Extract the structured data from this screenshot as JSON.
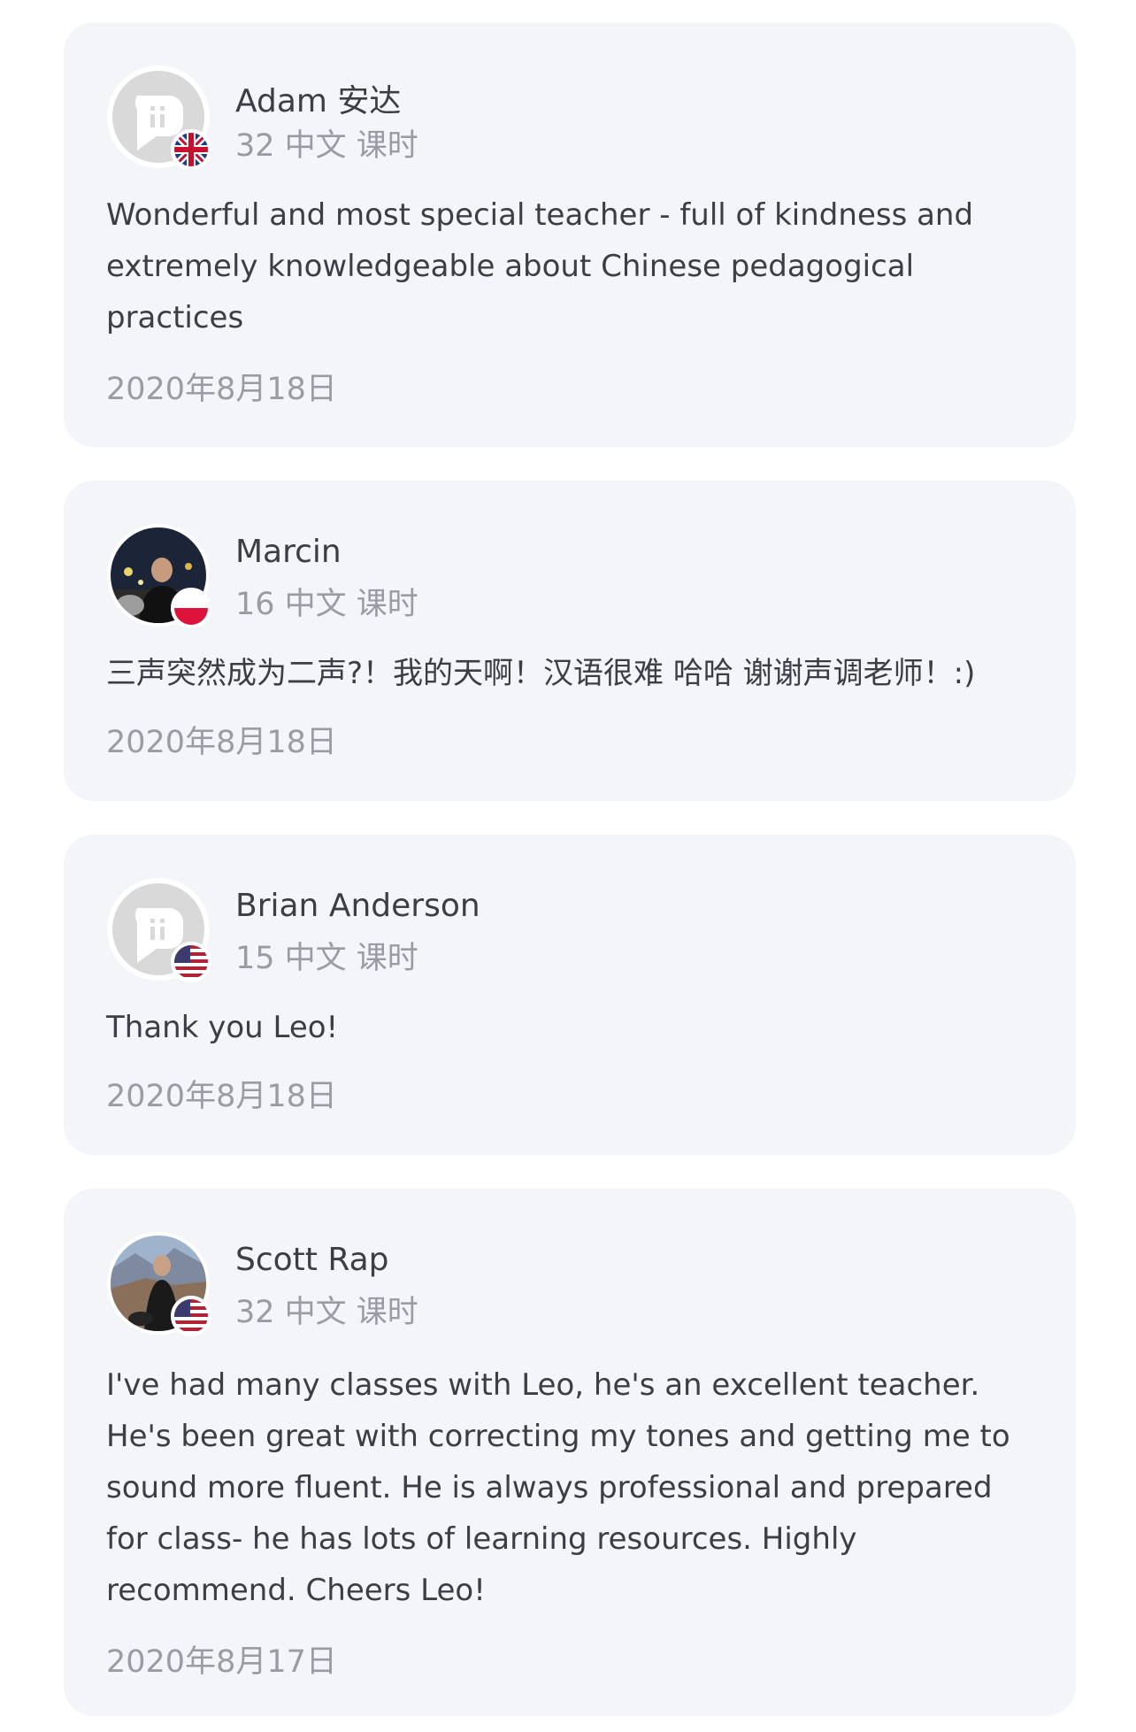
{
  "reviews": [
    {
      "name": "Adam 安达",
      "lessons": "32 中文 课时",
      "text": "Wonderful and most special teacher - full of kindness and extremely knowledgeable about Chinese pedagogical practices",
      "date": "2020年8月18日",
      "avatar": "default-avatar-icon",
      "flag": "uk-flag-icon"
    },
    {
      "name": "Marcin",
      "lessons": "16 中文 课时",
      "text": "三声突然成为二声?！我的天啊！汉语很难 哈哈 谢谢声调老师！:)",
      "date": "2020年8月18日",
      "avatar": "user-photo",
      "flag": "poland-flag-icon"
    },
    {
      "name": "Brian Anderson",
      "lessons": "15 中文 课时",
      "text": "Thank you Leo!",
      "date": "2020年8月18日",
      "avatar": "default-avatar-icon",
      "flag": "us-flag-icon"
    },
    {
      "name": "Scott Rap",
      "lessons": "32 中文 课时",
      "text": "I've had many classes with Leo, he's an excellent teacher. He's been great with correcting my tones and getting me to sound more fluent. He is always professional and prepared for class- he has lots of learning resources. Highly recommend. Cheers Leo!",
      "date": "2020年8月17日",
      "avatar": "user-photo",
      "flag": "us-flag-icon"
    }
  ],
  "colors": {
    "card_background": "#f4f5f9",
    "text_primary": "#3c3d45",
    "text_secondary": "#9a9ba4",
    "default_avatar": "#d9d9d9"
  }
}
